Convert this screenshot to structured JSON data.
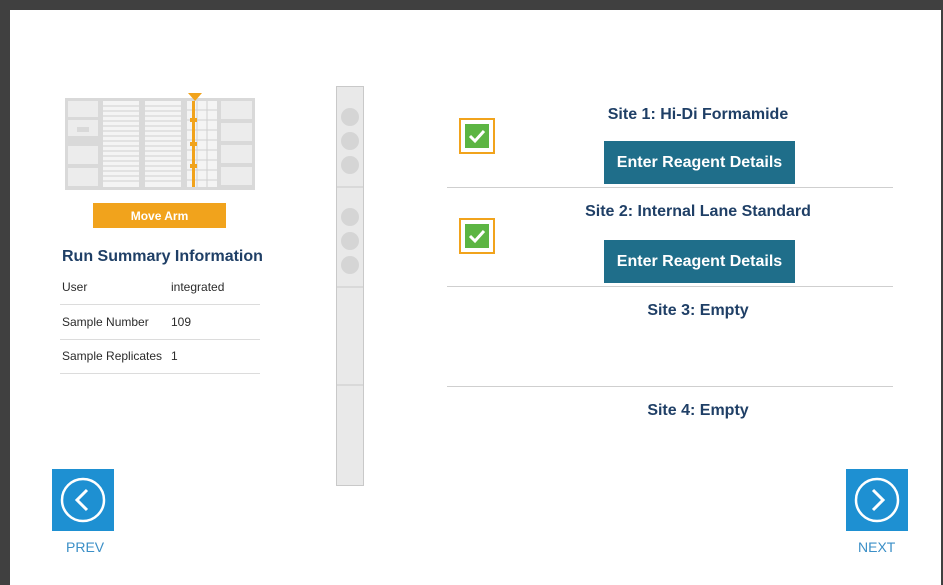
{
  "deck": {
    "move_arm_label": "Move Arm"
  },
  "run_summary": {
    "title": "Run Summary Information",
    "rows": [
      {
        "key": "User",
        "value": "integrated"
      },
      {
        "key": "Sample Number",
        "value": "109"
      },
      {
        "key": "Sample Replicates",
        "value": "1"
      }
    ]
  },
  "sites": [
    {
      "title": "Site 1: Hi-Di Formamide",
      "checked": true,
      "button_label": "Enter Reagent Details"
    },
    {
      "title": "Site 2: Internal Lane Standard",
      "checked": true,
      "button_label": "Enter Reagent Details"
    },
    {
      "title": "Site 3: Empty"
    },
    {
      "title": "Site 4: Empty"
    }
  ],
  "nav": {
    "prev_label": "PREV",
    "next_label": "NEXT"
  },
  "colors": {
    "accent": "#f1a31c",
    "button_teal": "#1f6e8a",
    "nav_blue": "#1e90d2",
    "heading": "#1f3f66",
    "check_green": "#5cb543"
  }
}
